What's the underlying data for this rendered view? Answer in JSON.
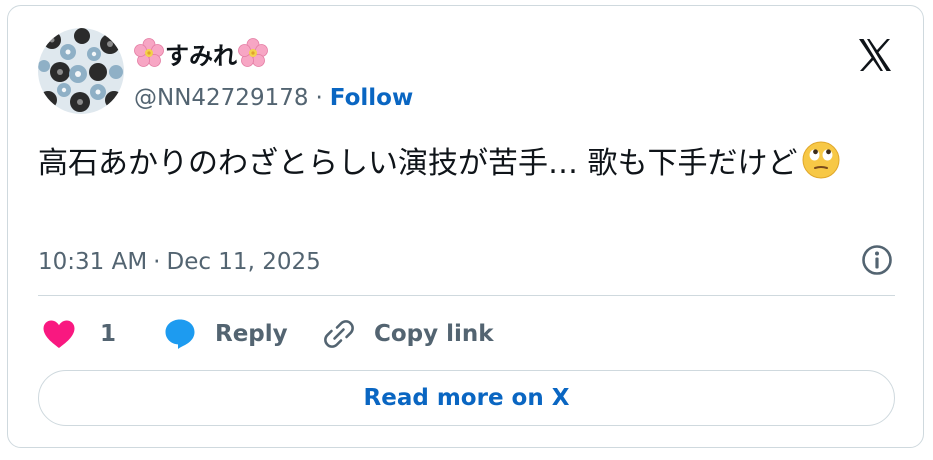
{
  "author": {
    "display_name": "すみれ",
    "name_emoji": "cherry-blossom",
    "handle": "@NN42729178",
    "separator": "·",
    "follow_label": "Follow",
    "avatar_icon": "floral-pattern-avatar"
  },
  "tweet": {
    "text": "高石あかりのわざとらしい演技が苦手… 歌も下手だけど",
    "trailing_emoji": "face-with-rolling-eyes"
  },
  "meta": {
    "time": "10:31 AM",
    "separator": "·",
    "date": "Dec 11, 2025"
  },
  "actions": {
    "like_count": "1",
    "reply_label": "Reply",
    "copy_link_label": "Copy link"
  },
  "read_more_label": "Read more on X",
  "icons": {
    "brand": "x-logo-icon",
    "info": "info-icon",
    "like": "heart-icon",
    "reply": "speech-bubble-icon",
    "copy": "link-icon"
  },
  "colors": {
    "link": "#0a66c2",
    "heart": "#f91880",
    "reply_bubble": "#1d9bf0",
    "muted_text": "#536471",
    "border": "#cfd9de"
  }
}
